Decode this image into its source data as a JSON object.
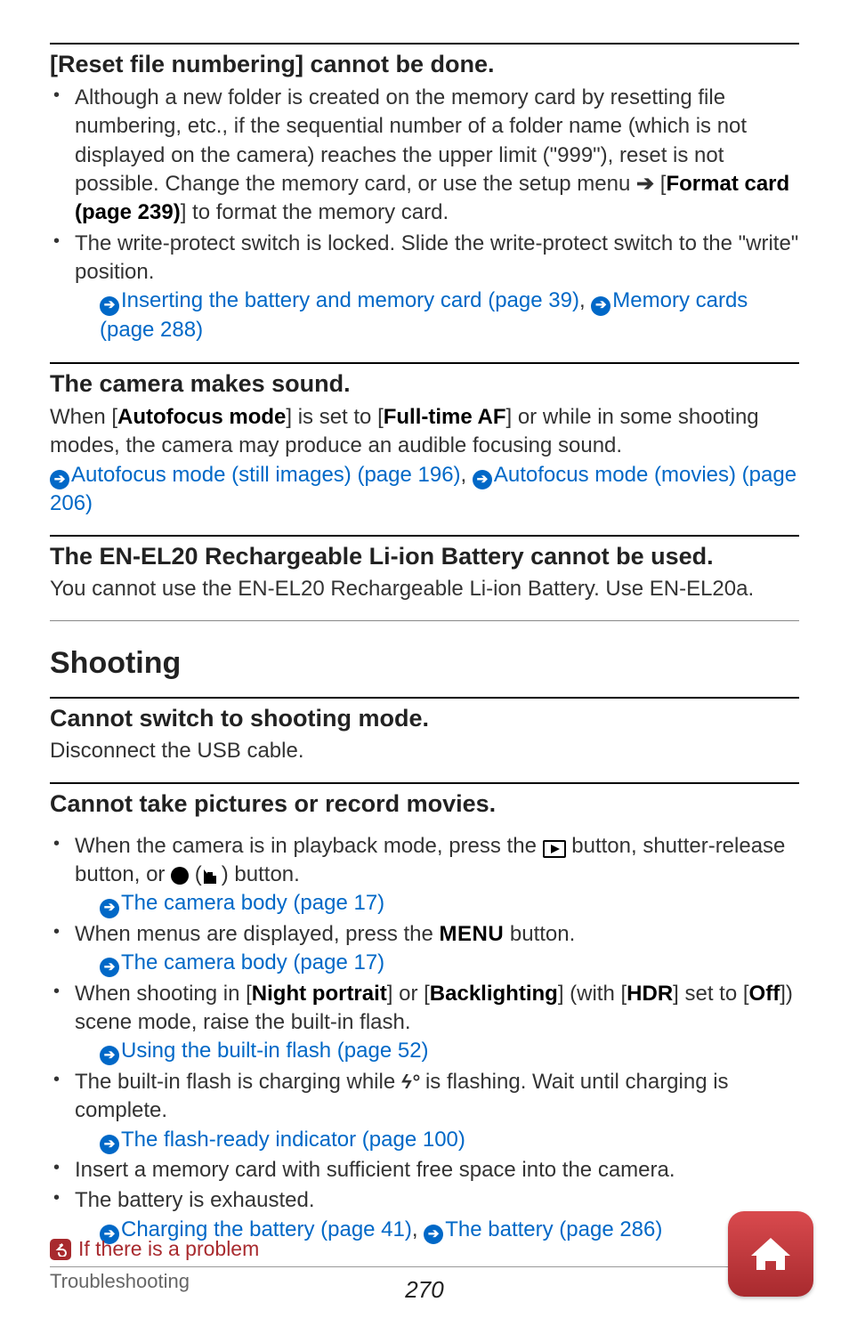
{
  "s1": {
    "title": "[Reset file numbering] cannot be done.",
    "b1a": "Although a new folder is created on the memory card by resetting file numbering, etc., if the sequential number of a folder name (which is not displayed on the camera) reaches the upper limit (\"999\"), reset is not possible. Change the memory card, or use the setup menu ",
    "b1b": " [",
    "b1bold": "Format card (page 239)",
    "b1c": "] to format the memory card.",
    "b2": "The write-protect switch is locked. Slide the write-protect switch to the \"write\" position.",
    "l1": "Inserting the battery and memory card (page 39)",
    "sep": ", ",
    "l2": "Memory cards (page 288)"
  },
  "s2": {
    "title": "The camera makes sound.",
    "p1a": "When [",
    "p1b1": "Autofocus mode",
    "p1c": "] is set to [",
    "p1b2": "Full-time AF",
    "p1d": "] or while in some shooting modes, the camera may produce an audible focusing sound.",
    "l1": "Autofocus mode (still images) (page 196)",
    "sep": ", ",
    "l2": "Autofocus mode (movies) (page 206)"
  },
  "s3": {
    "title": "The EN-EL20 Rechargeable Li-ion Battery cannot be used.",
    "p": "You cannot use the EN-EL20 Rechargeable Li-ion Battery. Use EN-EL20a."
  },
  "sectionTitle": "Shooting",
  "s4": {
    "title": "Cannot switch to shooting mode.",
    "p": "Disconnect the USB cable."
  },
  "s5": {
    "title": "Cannot take pictures or record movies.",
    "b1a": "When the camera is in playback mode, press the ",
    "b1b": " button, shutter-release button, or ",
    "b1c": " button.",
    "l1": "The camera body (page 17)",
    "b2a": "When menus are displayed, press the ",
    "b2b": " button.",
    "l2": "The camera body (page 17)",
    "b3a": "When shooting in [",
    "b3b1": "Night portrait",
    "b3b": "] or [",
    "b3b2": "Backlighting",
    "b3c": "] (with [",
    "b3b3": "HDR",
    "b3d": "] set to [",
    "b3b4": "Off",
    "b3e": "]) scene mode, raise the built-in flash.",
    "l3": "Using the built-in flash (page 52)",
    "b4a": "The built-in flash is charging while ",
    "b4b": " is flashing. Wait until charging is complete.",
    "l4": "The flash-ready indicator (page 100)",
    "b5": "Insert a memory card with sufficient free space into the camera.",
    "b6": "The battery is exhausted.",
    "l5": "Charging the battery (page 41)",
    "sep": ", ",
    "l6": "The battery (page 286)"
  },
  "pagenum": "270",
  "footer": {
    "section": "If there is a problem",
    "sub": "Troubleshooting"
  },
  "icons": {
    "menu": "MENU"
  }
}
